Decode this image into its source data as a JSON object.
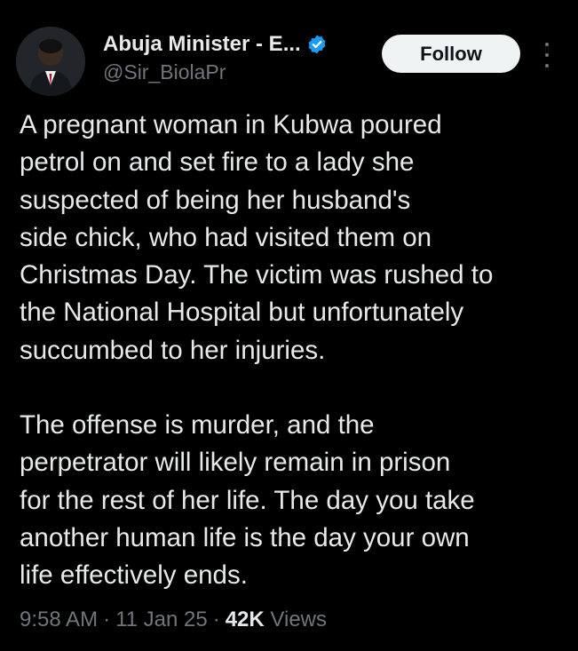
{
  "author": {
    "display_name": "Abuja Minister - E...",
    "handle": "@Sir_BiolaPr",
    "verified": true
  },
  "follow_button": {
    "label": "Follow"
  },
  "tweet": {
    "paragraphs": [
      "A pregnant woman in Kubwa poured petrol on and set fire to a lady she suspected of being her husband's side chick, who had visited them on Christmas Day. The victim was rushed to the National Hospital but unfortunately succumbed to her injuries.",
      "The offense is murder, and the perpetrator will likely remain in prison for the rest of her life. The day you take another human life is the day your own life effectively ends."
    ],
    "lines": [
      "A pregnant woman in Kubwa poured",
      "petrol on and set fire to a lady she",
      "suspected of being her husband's",
      "side chick, who had visited them on",
      "Christmas Day. The victim was rushed to",
      "the National Hospital but unfortunately",
      "succumbed to her injuries.",
      "The offense is murder, and the",
      "perpetrator will likely remain in prison",
      "for the rest of her life. The day you take",
      "another human life is the day your own",
      "life effectively ends."
    ]
  },
  "meta": {
    "time": "9:58 AM",
    "date": "11 Jan 25",
    "views_count": "42K",
    "views_label": "Views",
    "separator": "·"
  },
  "colors": {
    "background": "#000000",
    "text_primary": "#e7e9ea",
    "text_secondary": "#71767b",
    "verified_badge": "#1d9bf0",
    "follow_button_bg": "#eff3f4",
    "follow_button_text": "#0f1419"
  },
  "icons": {
    "verified": "verified-badge-icon",
    "more": "more-options-icon"
  }
}
